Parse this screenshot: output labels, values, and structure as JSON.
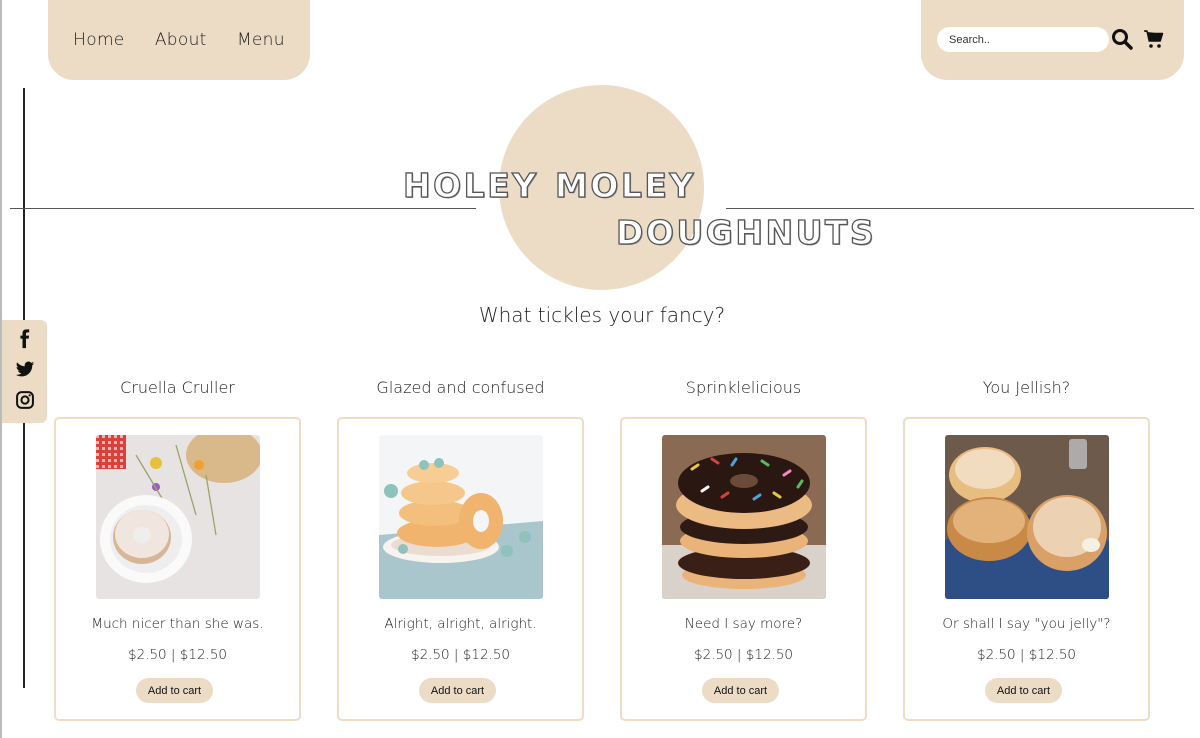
{
  "nav": {
    "items": [
      "Home",
      "About",
      "Menu"
    ]
  },
  "toolbar": {
    "search_placeholder": "Search..",
    "icons": [
      "search-icon",
      "cart-icon"
    ]
  },
  "brand": {
    "line1a": "HOLEY",
    "line1b": "MOLEY",
    "line2": "DOUGHNUTS"
  },
  "tagline": "What tickles your fancy?",
  "social": {
    "icons": [
      "facebook-icon",
      "twitter-icon",
      "instagram-icon"
    ]
  },
  "products": [
    {
      "title": "Cruella Cruller",
      "description": "Much nicer than she was.",
      "price": "$2.50 | $12.50",
      "button": "Add to cart"
    },
    {
      "title": "Glazed and confused",
      "description": "Alright, alright, alright.",
      "price": "$2.50 | $12.50",
      "button": "Add to cart"
    },
    {
      "title": "Sprinklelicious",
      "description": "Need I say more?",
      "price": "$2.50 | $12.50",
      "button": "Add to cart"
    },
    {
      "title": "You Jellish?",
      "description": "Or shall I say \"you jelly\"?",
      "price": "$2.50 | $12.50",
      "button": "Add to cart"
    }
  ],
  "colors": {
    "accent": "#ecdcc6",
    "card_border": "#f0dcc2",
    "text": "#222222"
  }
}
